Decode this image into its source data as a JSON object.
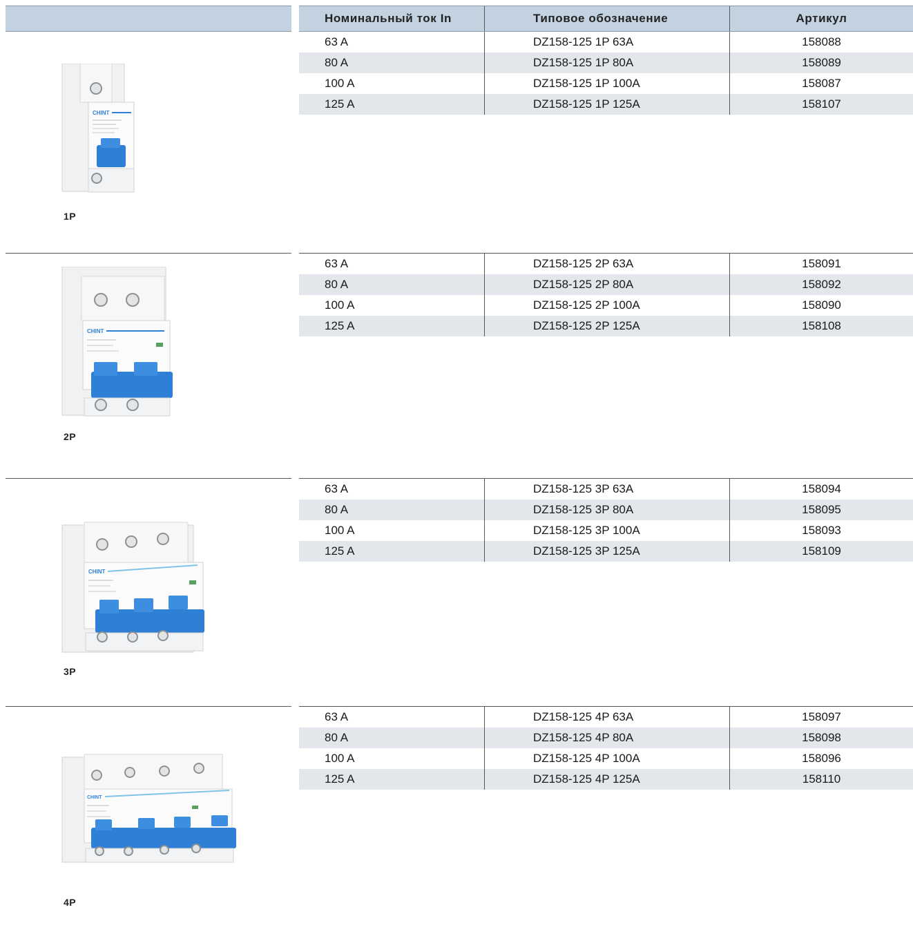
{
  "table": {
    "headers": [
      "Номинальный ток  In",
      "Типовое обозначение",
      "Артикул"
    ]
  },
  "sections": [
    {
      "pole": "1P",
      "rows": [
        [
          "63 A",
          "DZ158-125 1P 63A",
          "158088"
        ],
        [
          "80 A",
          "DZ158-125 1P 80A",
          "158089"
        ],
        [
          "100 A",
          "DZ158-125 1P 100A",
          "158087"
        ],
        [
          "125 A",
          "DZ158-125 1P 125A",
          "158107"
        ]
      ]
    },
    {
      "pole": "2P",
      "rows": [
        [
          "63 A",
          "DZ158-125 2P 63A",
          "158091"
        ],
        [
          "80 A",
          "DZ158-125 2P 80A",
          "158092"
        ],
        [
          "100 A",
          "DZ158-125 2P 100A",
          "158090"
        ],
        [
          "125 A",
          "DZ158-125 2P 125A",
          "158108"
        ]
      ]
    },
    {
      "pole": "3P",
      "rows": [
        [
          "63 A",
          "DZ158-125 3P 63A",
          "158094"
        ],
        [
          "80 A",
          "DZ158-125 3P 80A",
          "158095"
        ],
        [
          "100 A",
          "DZ158-125 3P 100A",
          "158093"
        ],
        [
          "125 A",
          "DZ158-125 3P 125A",
          "158109"
        ]
      ]
    },
    {
      "pole": "4P",
      "rows": [
        [
          "63 A",
          "DZ158-125 4P 63A",
          "158097"
        ],
        [
          "80 A",
          "DZ158-125 4P 80A",
          "158098"
        ],
        [
          "100 A",
          "DZ158-125 4P 100A",
          "158096"
        ],
        [
          "125 A",
          "DZ158-125 4P 125A",
          "158110"
        ]
      ]
    }
  ],
  "brand_logo": "CHINT",
  "colors": {
    "header_bg": "#c3d2e0",
    "row_shade": "#e3e6ea",
    "breaker_blue": "#2f7fd6"
  }
}
